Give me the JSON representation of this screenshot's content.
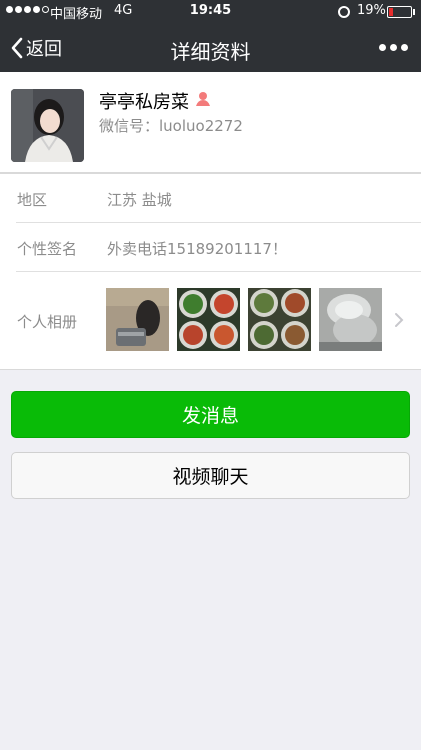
{
  "status_bar": {
    "carrier": "中国移动",
    "network": "4G",
    "time": "19:45",
    "battery": "19%",
    "battery_level": 0.19,
    "signal_bars": 4,
    "alarm_icon": "alarm-clock-icon"
  },
  "nav": {
    "back_label": "返回",
    "title": "详细资料",
    "more_icon": "more-dots-icon"
  },
  "profile": {
    "name": "亭亭私房菜",
    "gender_icon": "female-icon",
    "wechat_id": "微信号：luoluo2272"
  },
  "info": {
    "region_label": "地区",
    "region_value": "江苏  盐城",
    "signature_label": "个性签名",
    "signature_value": "外卖电话15189201117！",
    "album_label": "个人相册"
  },
  "buttons": {
    "send_message": "发消息",
    "video_chat": "视频聊天"
  },
  "colors": {
    "bar_bg": "#2e3135",
    "primary_green": "#09bb07",
    "page_bg": "#efeff4",
    "battery_low": "#e62d2d"
  }
}
